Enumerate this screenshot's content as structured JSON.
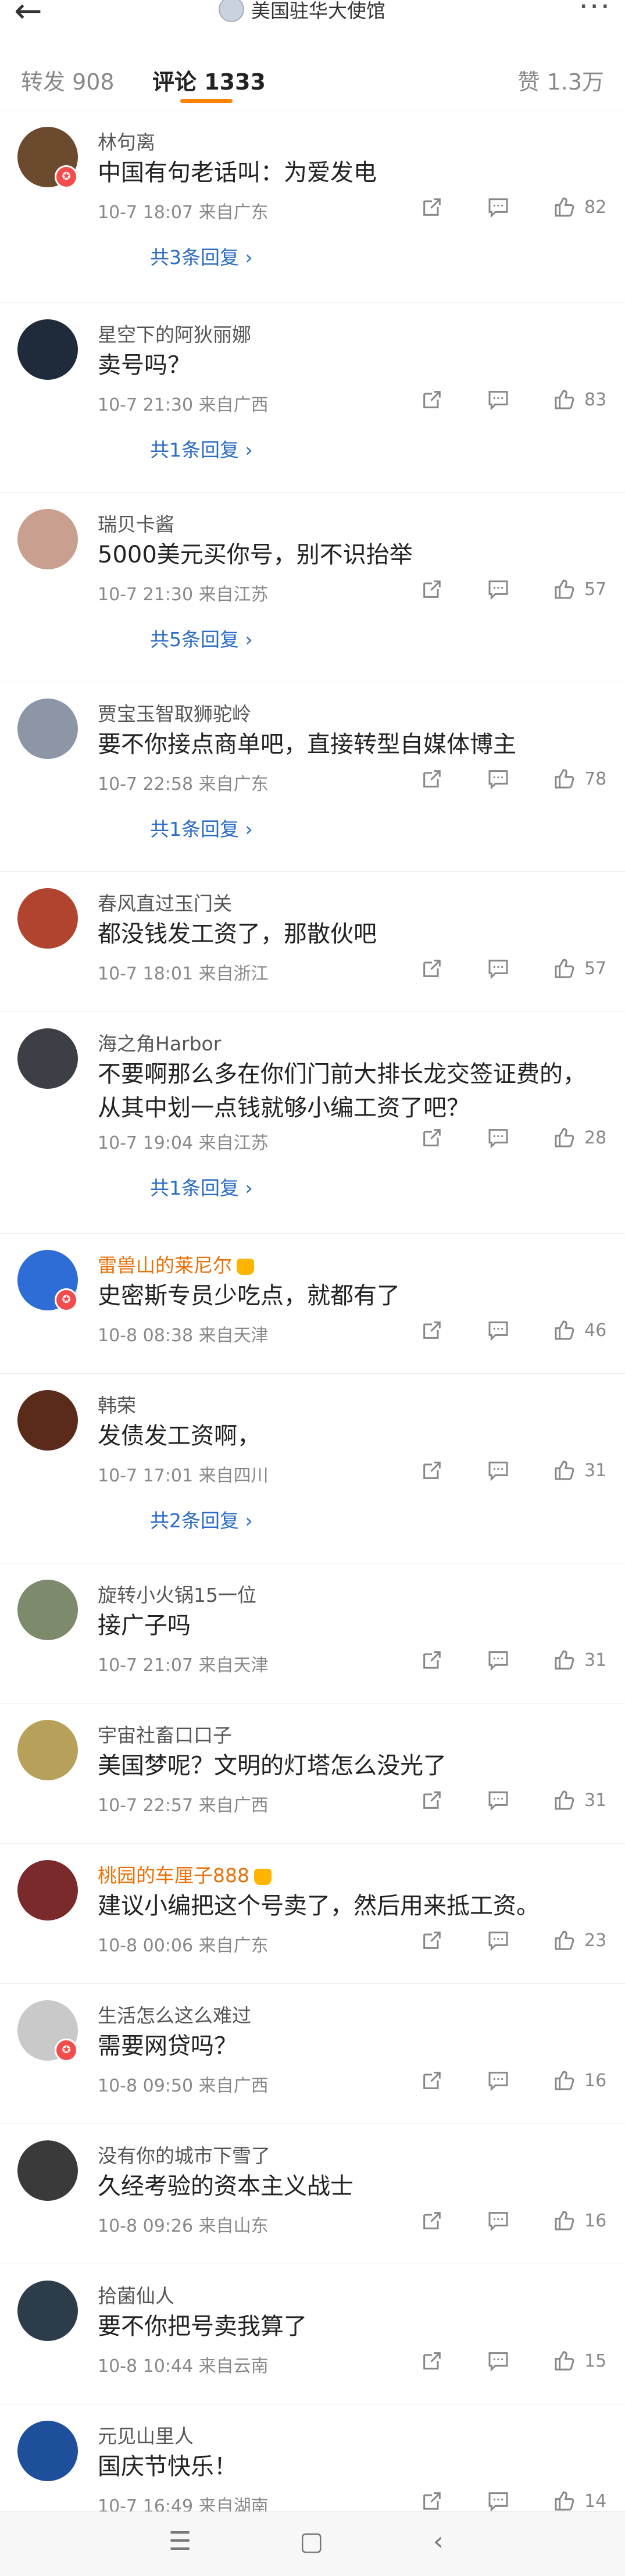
{
  "header": {
    "back_icon": "arrow-left-icon",
    "title": "美国驻华大使馆",
    "more_icon": "more-dots-icon"
  },
  "tabs": {
    "repost": "转发 908",
    "comments": "评论 1333",
    "likes": "赞 1.3万"
  },
  "comments": [
    {
      "name": "林句离",
      "text": "中国有句老话叫：为爱发电",
      "meta": "10-7 18:07  来自广东",
      "likes": "82",
      "replies": "共3条回复 ›",
      "avatar_color": "#6b4a2e"
    },
    {
      "name": "星空下的阿狄丽娜",
      "text": "卖号吗？",
      "meta": "10-7 21:30  来自广西",
      "likes": "83",
      "replies": "共1条回复 ›",
      "avatar_color": "#1f2a3a"
    },
    {
      "name": "瑞贝卡酱",
      "text": "5000美元买你号，别不识抬举",
      "meta": "10-7 21:30  来自江苏",
      "likes": "57",
      "replies": "共5条回复 ›",
      "avatar_color": "#c9a08f"
    },
    {
      "name": "贾宝玉智取狮驼岭",
      "text": "要不你接点商单吧，直接转型自媒体博主",
      "meta": "10-7 22:58  来自广东",
      "likes": "78",
      "replies": "共1条回复 ›",
      "avatar_color": "#8c96a6"
    },
    {
      "name": "春风直过玉门关",
      "text": "都没钱发工资了，那散伙吧",
      "meta": "10-7 18:01  来自浙江",
      "likes": "57",
      "replies": "",
      "avatar_color": "#b0442f"
    },
    {
      "name": "海之角Harbor",
      "text": "不要啊那么多在你们门前大排长龙交签证费的，从其中划一点钱就够小编工资了吧？",
      "meta": "10-7 19:04  来自江苏",
      "likes": "28",
      "replies": "共1条回复 ›",
      "avatar_color": "#3c3f45"
    },
    {
      "name": "雷兽山的莱尼尔",
      "text": "史密斯专员少吃点，就都有了",
      "meta": "10-8 08:38  来自天津",
      "likes": "46",
      "replies": "",
      "avatar_color": "#2e6dd6"
    },
    {
      "name": "韩荣",
      "text": "发债发工资啊，",
      "meta": "10-7 17:01  来自四川",
      "likes": "31",
      "replies": "共2条回复 ›",
      "avatar_color": "#5a2a1a"
    },
    {
      "name": "旋转小火锅15一位",
      "text": "接广子吗",
      "meta": "10-7 21:07  来自天津",
      "likes": "31",
      "replies": "",
      "avatar_color": "#7d8a6b"
    },
    {
      "name": "宇宙社畜口口子",
      "text": "美国梦呢？文明的灯塔怎么没光了",
      "meta": "10-7 22:57  来自广西",
      "likes": "31",
      "replies": "",
      "avatar_color": "#b7a15a"
    },
    {
      "name": "桃园的车厘子888",
      "text": "建议小编把这个号卖了，然后用来抵工资。",
      "meta": "10-8 00:06  来自广东",
      "likes": "23",
      "replies": "",
      "avatar_color": "#7a2a2a"
    },
    {
      "name": "生活怎么这么难过",
      "text": "需要网贷吗？",
      "meta": "10-8 09:50  来自广西",
      "likes": "16",
      "replies": "",
      "avatar_color": "#c9c9c9"
    },
    {
      "name": "没有你的城市下雪了",
      "text": "久经考验的资本主义战士",
      "meta": "10-8 09:26  来自山东",
      "likes": "16",
      "replies": "",
      "avatar_color": "#3a3a3a"
    },
    {
      "name": "拾菌仙人",
      "text": "要不你把号卖我算了",
      "meta": "10-8 10:44  来自云南",
      "likes": "15",
      "replies": "",
      "avatar_color": "#2d3c4a"
    },
    {
      "name": "元见山里人",
      "text": "国庆节快乐！",
      "meta": "10-7 16:49  来自湖南",
      "likes": "14",
      "replies": "",
      "avatar_color": "#1d4f9a"
    }
  ],
  "bottom_nav": {
    "menu_icon": "menu-icon",
    "home_icon": "home-square-icon",
    "back_icon": "back-chevron-icon"
  },
  "accent_color": "#ff8200"
}
